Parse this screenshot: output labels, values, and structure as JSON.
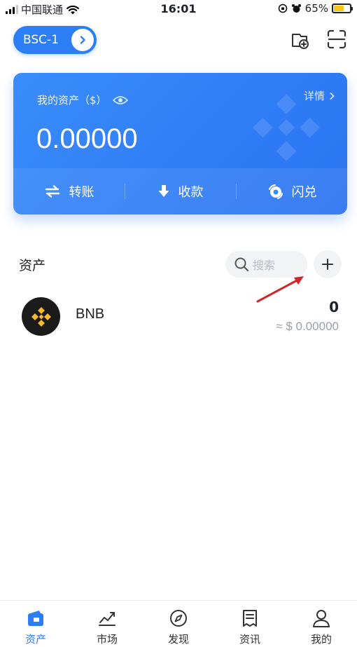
{
  "status_bar": {
    "carrier": "中国联通",
    "time": "16:01",
    "battery": "65%"
  },
  "header": {
    "chain_label": "BSC-1"
  },
  "card": {
    "label": "我的资产（$）",
    "detail": "详情",
    "amount": "0.00000",
    "actions": [
      "转账",
      "收款",
      "闪兑"
    ]
  },
  "assets": {
    "title": "资产",
    "search_placeholder": "搜索",
    "items": [
      {
        "name": "BNB",
        "amount": "0",
        "value": "≈ $ 0.00000"
      }
    ]
  },
  "tabbar": {
    "active": "资产",
    "tabs": [
      "资产",
      "市场",
      "发现",
      "资讯",
      "我的"
    ]
  },
  "colors": {
    "accent": "#2d7ef5",
    "coin_gold": "#f3ba2f",
    "annotation_red": "#d0232a"
  }
}
